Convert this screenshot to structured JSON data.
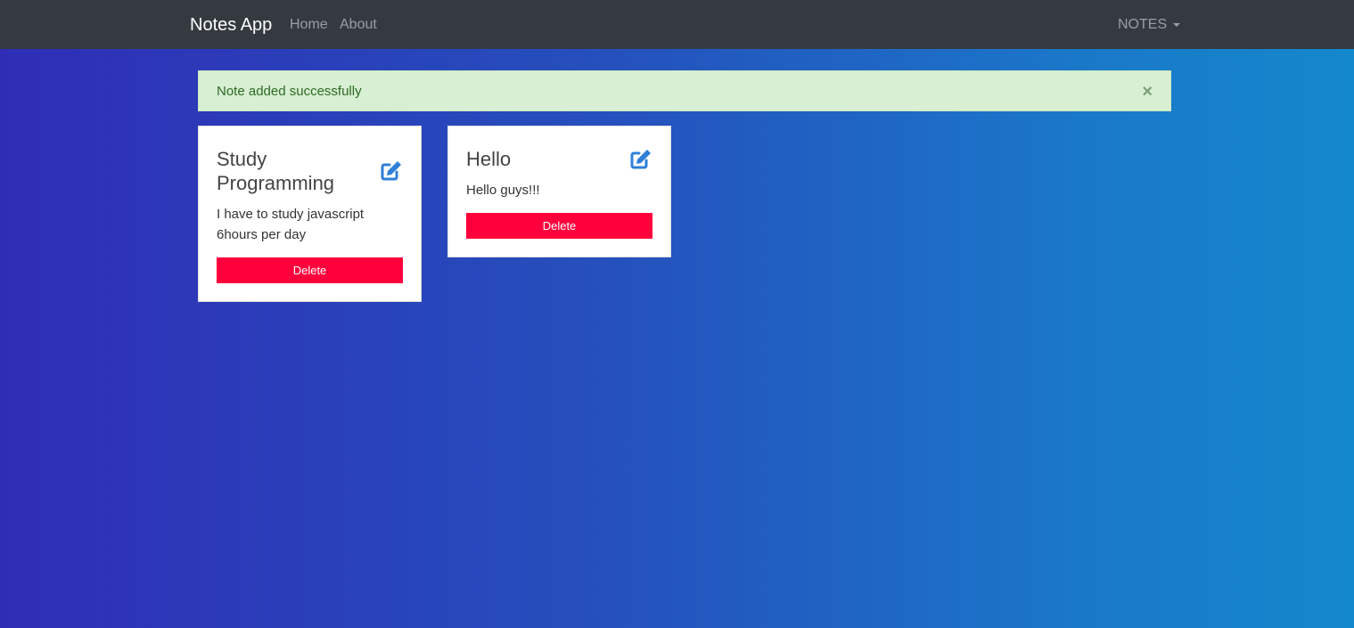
{
  "navbar": {
    "brand": "Notes App",
    "links": [
      "Home",
      "About"
    ],
    "dropdown_label": "NOTES"
  },
  "alert": {
    "message": "Note added successfully",
    "close_glyph": "×"
  },
  "notes": [
    {
      "title": "Study Programming",
      "body": "I have to study javascript 6hours per day",
      "delete_label": "Delete"
    },
    {
      "title": "Hello",
      "body": "Hello guys!!!",
      "delete_label": "Delete"
    }
  ],
  "colors": {
    "accent_edit_icon": "#2f7fd8",
    "delete_button": "#ff003c",
    "alert_bg": "#d8efd3",
    "navbar_bg": "#343a40"
  },
  "icons": {
    "edit": "edit-icon",
    "caret": "chevron-down-icon",
    "close": "close-icon"
  }
}
